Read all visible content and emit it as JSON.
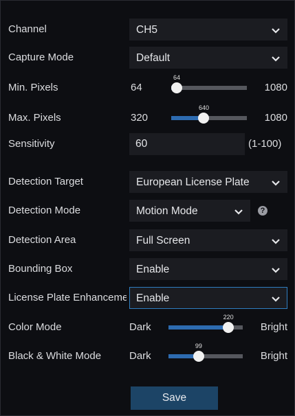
{
  "settings": {
    "channel": {
      "label": "Channel",
      "value": "CH5"
    },
    "capture_mode": {
      "label": "Capture Mode",
      "value": "Default"
    },
    "min_pixels": {
      "label": "Min. Pixels",
      "min": "64",
      "max": "1080",
      "current": "64",
      "level": 0
    },
    "max_pixels": {
      "label": "Max. Pixels",
      "min": "320",
      "max": "1080",
      "current": "640",
      "level": 0.42
    },
    "sensitivity": {
      "label": "Sensitivity",
      "value": "60",
      "range": "(1-100)"
    },
    "detection_target": {
      "label": "Detection Target",
      "value": "European License Plate"
    },
    "detection_mode": {
      "label": "Detection Mode",
      "value": "Motion Mode"
    },
    "detection_area": {
      "label": "Detection Area",
      "value": "Full Screen"
    },
    "bounding_box": {
      "label": "Bounding Box",
      "value": "Enable"
    },
    "plate_enhancement": {
      "label": "License Plate Enhancement",
      "value": "Enable"
    },
    "color_mode": {
      "label": "Color Mode",
      "min": "Dark",
      "max": "Bright",
      "current": "220",
      "level": 0.86
    },
    "bw_mode": {
      "label": "Black & White Mode",
      "min": "Dark",
      "max": "Bright",
      "current": "99",
      "level": 0.39
    }
  },
  "icons": {
    "chevron": "chevron-down-icon",
    "help": "question-circle-icon"
  },
  "help_glyph": "?",
  "save_label": "Save",
  "colors": {
    "background": "#0d0e12",
    "field": "#1b1c21",
    "accent": "#2d6bb0",
    "active_border": "#2f7fc2",
    "save_button": "#1c4466"
  }
}
